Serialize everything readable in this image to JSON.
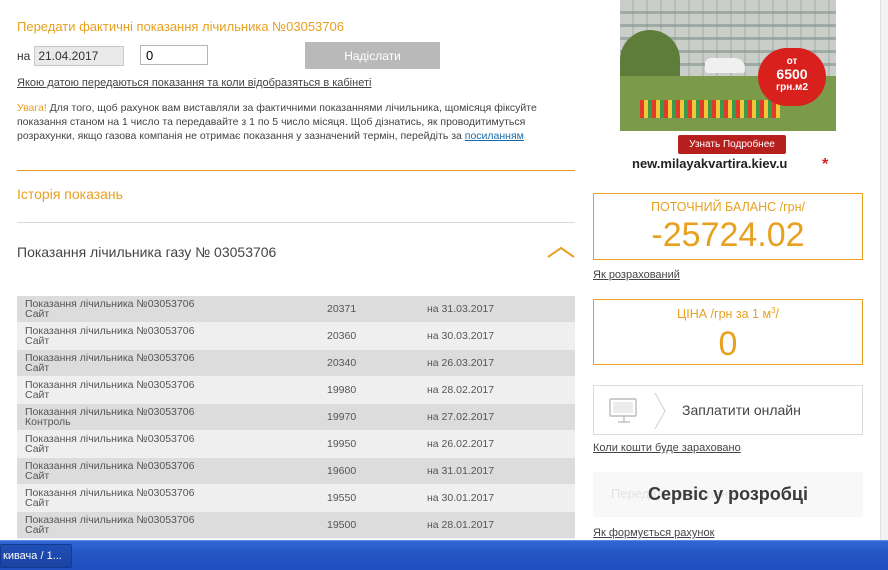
{
  "submit": {
    "title": "Передати фактичні показання лічильника №03053706",
    "date_label": "на",
    "date_value": "21.04.2017",
    "reading_value": "0",
    "send_label": "Надіслати",
    "info_link": "Якою датою передаються показання та коли відобразяться в кабінеті",
    "note_warn": "Увага!",
    "note_text": " Для того, щоб рахунок вам виставляли за фактичними показаннями лічильника, щомісяця фіксуйте показання станом на 1 число та передавайте з 1 по 5 число місяця. Щоб дізнатись, як проводитимуться розрахунки, якщо газова компанія не отримає показання у зазначений термін, перейдіть за ",
    "note_link": "посиланням"
  },
  "history": {
    "title": "Історія показань",
    "meter_title": "Показання лічильника газу № 03053706",
    "rows": [
      {
        "name": "Показання лічильника №03053706",
        "source": "Сайт",
        "reading": "20371",
        "date": "на 31.03.2017"
      },
      {
        "name": "Показання лічильника №03053706",
        "source": "Сайт",
        "reading": "20360",
        "date": "на 30.03.2017"
      },
      {
        "name": "Показання лічильника №03053706",
        "source": "Сайт",
        "reading": "20340",
        "date": "на 26.03.2017"
      },
      {
        "name": "Показання лічильника №03053706",
        "source": "Сайт",
        "reading": "19980",
        "date": "на 28.02.2017"
      },
      {
        "name": "Показання лічильника №03053706",
        "source": "Контроль",
        "reading": "19970",
        "date": "на 27.02.2017"
      },
      {
        "name": "Показання лічильника №03053706",
        "source": "Сайт",
        "reading": "19950",
        "date": "на 26.02.2017"
      },
      {
        "name": "Показання лічильника №03053706",
        "source": "Сайт",
        "reading": "19600",
        "date": "на 31.01.2017"
      },
      {
        "name": "Показання лічильника №03053706",
        "source": "Сайт",
        "reading": "19550",
        "date": "на 30.01.2017"
      },
      {
        "name": "Показання лічильника №03053706",
        "source": "Сайт",
        "reading": "19500",
        "date": "на 28.01.2017"
      }
    ]
  },
  "ad": {
    "price_top": "от",
    "price_value": "6500",
    "price_unit": "грн.м2",
    "more_label": "Узнать Подробнее",
    "site": "new.milayakvartira.kiev.u"
  },
  "balance": {
    "caption": "ПОТОЧНИЙ БАЛАНС /грн/",
    "value": "-25724.02",
    "link": "Як розрахований"
  },
  "price": {
    "caption_pre": "ЦІНА /грн за 1 м",
    "caption_sup": "3",
    "caption_post": "/",
    "value": "0"
  },
  "pay": {
    "label": "Заплатити онлайн",
    "link": "Коли кошти буде зараховано"
  },
  "service": {
    "ghost": "Передати показання",
    "label": "Сервіс у розробці",
    "link": "Як формується рахунок"
  },
  "taskbar": {
    "item": "кивача / 1..."
  },
  "colors": {
    "accent": "#e8a020",
    "taskbar": "#2456c4",
    "ad_red": "#d8201c"
  }
}
